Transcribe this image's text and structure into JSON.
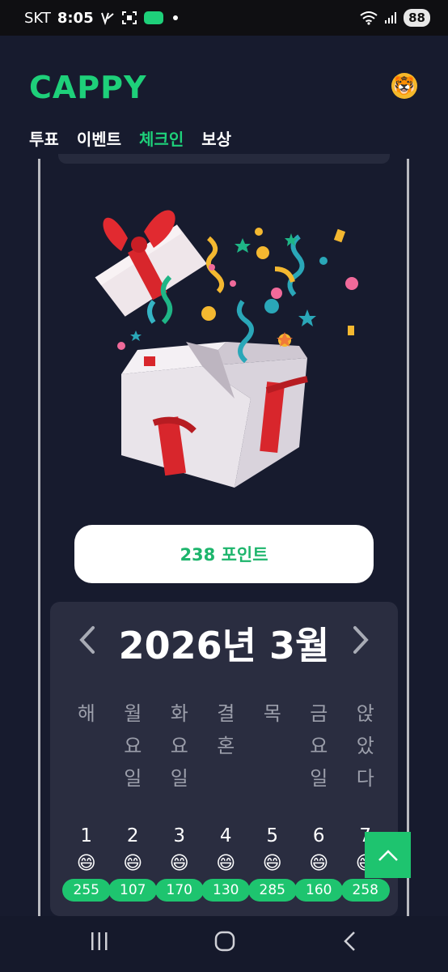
{
  "status_bar": {
    "carrier": "SKT",
    "time": "8:05",
    "battery": "88"
  },
  "header": {
    "logo": "CAPPY"
  },
  "nav": {
    "items": [
      {
        "label": "투표"
      },
      {
        "label": "이벤트"
      },
      {
        "label": "체크인"
      },
      {
        "label": "보상"
      }
    ],
    "active": "체크인"
  },
  "points_button": {
    "label": "238 포인트"
  },
  "calendar": {
    "title": "2026년 3월",
    "weekdays": [
      [
        "해"
      ],
      [
        "월",
        "요",
        "일"
      ],
      [
        "화",
        "요",
        "일"
      ],
      [
        "결",
        "혼"
      ],
      [
        "목"
      ],
      [
        "금",
        "요",
        "일"
      ],
      [
        "앉",
        "았",
        "다"
      ]
    ],
    "days": [
      {
        "day": "1",
        "emoji": "😄",
        "points": "255"
      },
      {
        "day": "2",
        "emoji": "😄",
        "points": "107"
      },
      {
        "day": "3",
        "emoji": "😄",
        "points": "170"
      },
      {
        "day": "4",
        "emoji": "😄",
        "points": "130"
      },
      {
        "day": "5",
        "emoji": "😄",
        "points": "285"
      },
      {
        "day": "6",
        "emoji": "😄",
        "points": "160"
      },
      {
        "day": "7",
        "emoji": "😄",
        "points": "258"
      }
    ]
  },
  "colors": {
    "accent": "#1ed07a",
    "background": "#171b2e",
    "panel": "#2a2d40"
  }
}
